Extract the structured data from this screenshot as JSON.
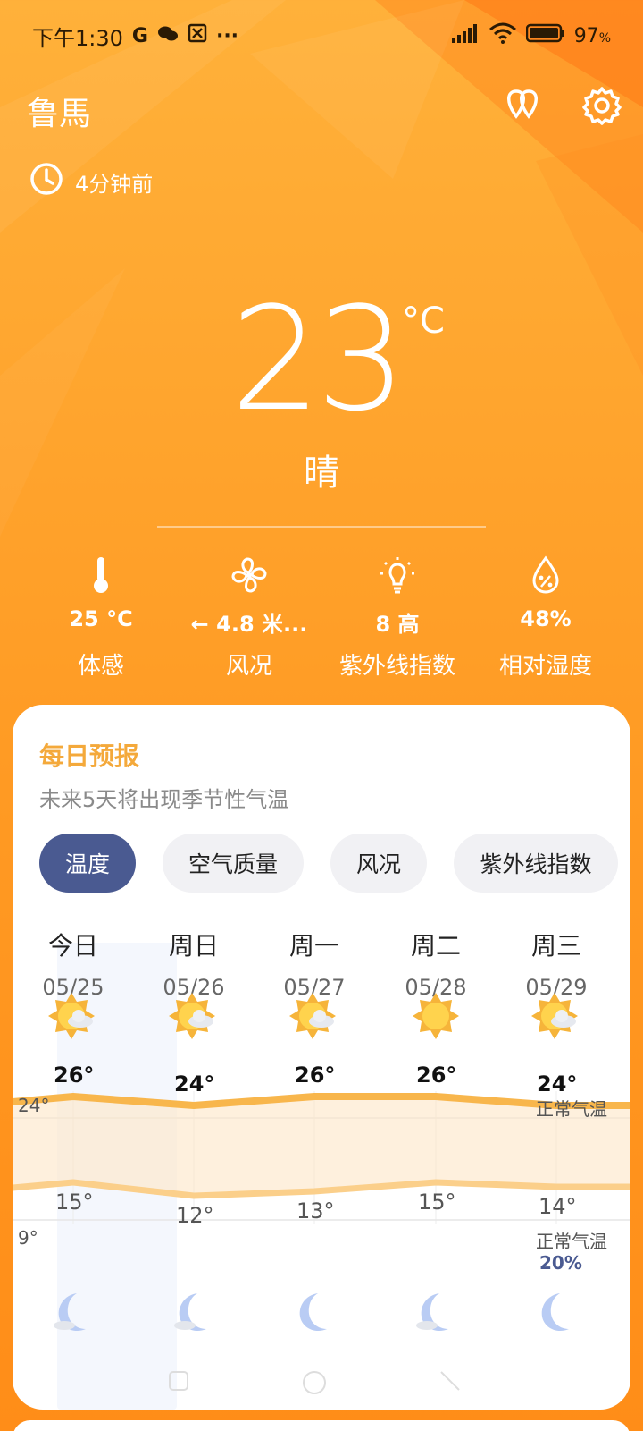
{
  "status_bar": {
    "time": "下午1:30",
    "indicators": [
      "G",
      "wechat-icon",
      "app-icon",
      "···"
    ],
    "battery": "97"
  },
  "header": {
    "city": "鲁馬",
    "updated": "4分钟前",
    "icons": [
      "location-pins-icon",
      "gear-icon"
    ]
  },
  "current": {
    "temperature": "23",
    "unit": "°C",
    "condition": "晴"
  },
  "metrics": [
    {
      "icon": "thermometer-icon",
      "value": "25 °C",
      "label": "体感"
    },
    {
      "icon": "fan-icon",
      "value": "← 4.8 米...",
      "label": "风况"
    },
    {
      "icon": "bulb-icon",
      "value": "8 高",
      "label": "紫外线指数"
    },
    {
      "icon": "droplet-icon",
      "value": "48%",
      "label": "相对湿度"
    }
  ],
  "forecast": {
    "title": "每日预报",
    "subtitle": "未来5天将出现季节性气温",
    "tabs": [
      "温度",
      "空气质量",
      "风况",
      "紫外线指数"
    ],
    "active_tab": 0,
    "days": [
      {
        "name": "今日",
        "date": "05/25",
        "icon": "sun-cloud-icon",
        "high": "26°",
        "low": "15°",
        "high_v": 26,
        "low_v": 15,
        "night_icon": "moon-cloud-icon"
      },
      {
        "name": "周日",
        "date": "05/26",
        "icon": "sun-cloud-icon",
        "high": "24°",
        "low": "12°",
        "high_v": 24,
        "low_v": 12,
        "night_icon": "moon-cloud-icon"
      },
      {
        "name": "周一",
        "date": "05/27",
        "icon": "sun-cloud-icon",
        "high": "26°",
        "low": "13°",
        "high_v": 26,
        "low_v": 13,
        "night_icon": "moon-icon"
      },
      {
        "name": "周二",
        "date": "05/28",
        "icon": "sun-icon",
        "high": "26°",
        "low": "15°",
        "high_v": 26,
        "low_v": 15,
        "night_icon": "moon-cloud-icon"
      },
      {
        "name": "周三",
        "date": "05/29",
        "icon": "sun-cloud-icon",
        "high": "24°",
        "low": "14°",
        "high_v": 24,
        "low_v": 14,
        "night_icon": "moon-icon"
      }
    ],
    "normal_high": "24°",
    "normal_low": "9°",
    "normal_label_top": "正常气温",
    "normal_label_bottom": "正常气温",
    "precip": "20%"
  },
  "colors": {
    "accent_orange": "#f4a93b",
    "tab_active": "#4a5a91",
    "band_fill": "#fde6c6"
  }
}
